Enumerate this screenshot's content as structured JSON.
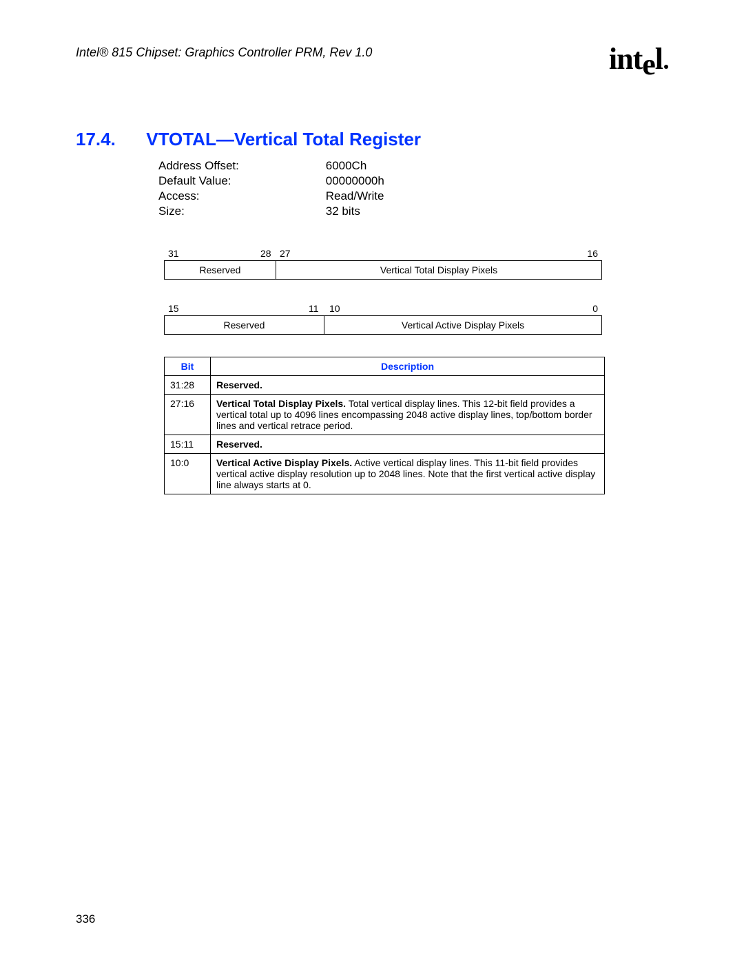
{
  "header": {
    "docline": "Intel® 815 Chipset: Graphics Controller PRM, Rev 1.0"
  },
  "logo": {
    "text_left": "int",
    "text_e": "e",
    "text_right": "l"
  },
  "section": {
    "number": "17.4.",
    "title": "VTOTAL—Vertical Total Register"
  },
  "meta": {
    "addr_label": "Address Offset:",
    "addr_val": "6000Ch",
    "default_label": "Default Value:",
    "default_val": "00000000h",
    "access_label": "Access:",
    "access_val": "Read/Write",
    "size_label": "Size:",
    "size_val": "32 bits"
  },
  "bf1": {
    "b31": "31",
    "b28": "28",
    "b27": "27",
    "b16": "16",
    "cell_a": "Reserved",
    "cell_b": "Vertical Total Display Pixels"
  },
  "bf2": {
    "b15": "15",
    "b11": "11",
    "b10": "10",
    "b0": "0",
    "cell_a": "Reserved",
    "cell_b": "Vertical Active Display Pixels"
  },
  "table": {
    "th_bit": "Bit",
    "th_desc": "Description",
    "rows": [
      {
        "bit": "31:28",
        "bold": "Reserved.",
        "rest": ""
      },
      {
        "bit": "27:16",
        "bold": "Vertical Total Display Pixels.",
        "rest": " Total vertical display lines. This 12-bit field provides a vertical total up to 4096 lines encompassing 2048 active display lines, top/bottom border lines and vertical retrace period."
      },
      {
        "bit": "15:11",
        "bold": "Reserved.",
        "rest": ""
      },
      {
        "bit": "10:0",
        "bold": "Vertical Active Display Pixels.",
        "rest": " Active vertical display lines. This 11-bit field provides vertical active display resolution up to 2048 lines. Note that the first vertical active display line always starts at 0."
      }
    ]
  },
  "page_number": "336"
}
